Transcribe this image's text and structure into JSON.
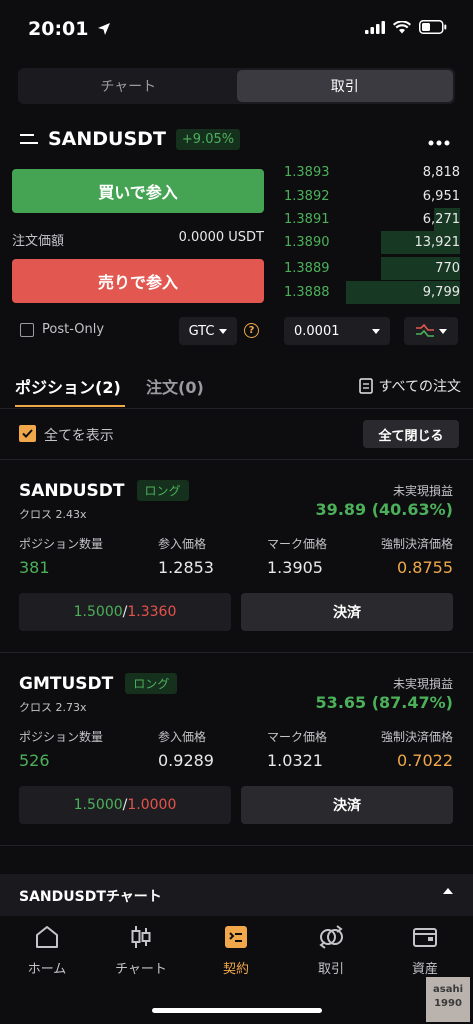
{
  "status_bar": {
    "time": "20:01"
  },
  "segmented": {
    "chart_label": "チャート",
    "trade_label": "取引"
  },
  "pair": {
    "name": "SANDUSDT",
    "change": "+9.05%"
  },
  "order_form": {
    "buy_label": "買いで参入",
    "sell_label": "売りで参入",
    "order_amount_label": "注文価額",
    "order_amount_value": "0.0000 USDT",
    "post_only_label": "Post-Only",
    "tif_value": "GTC",
    "help_glyph": "?"
  },
  "orderbook": {
    "step_value": "0.0001",
    "rows": [
      {
        "price": "1.3893",
        "qty": "8,818",
        "depth": 0.0
      },
      {
        "price": "1.3892",
        "qty": "6,951",
        "depth": 0.0
      },
      {
        "price": "1.3891",
        "qty": "6,271",
        "depth": 0.15
      },
      {
        "price": "1.3890",
        "qty": "13,921",
        "depth": 0.45
      },
      {
        "price": "1.3889",
        "qty": "770",
        "depth": 0.45
      },
      {
        "price": "1.3888",
        "qty": "9,799",
        "depth": 0.65
      }
    ]
  },
  "tabs": {
    "positions_label": "ポジション(2)",
    "orders_label": "注文(0)",
    "all_orders_label": "すべての注文"
  },
  "filters": {
    "show_all_label": "全てを表示",
    "close_all_label": "全て閉じる"
  },
  "position_headers": {
    "pnl": "未実現損益",
    "qty": "ポジション数量",
    "entry": "参入価格",
    "mark": "マーク価格",
    "liq": "強制決済価格",
    "settle": "決済"
  },
  "positions": [
    {
      "symbol": "SANDUSDT",
      "side": "ロング",
      "cross": "クロス 2.43x",
      "pnl": "39.89 (40.63%)",
      "qty": "381",
      "entry": "1.2853",
      "mark": "1.3905",
      "liq": "0.8755",
      "tp": "1.5000",
      "sep": "/",
      "sl": "1.3360"
    },
    {
      "symbol": "GMTUSDT",
      "side": "ロング",
      "cross": "クロス 2.73x",
      "pnl": "53.65 (87.47%)",
      "qty": "526",
      "entry": "0.9289",
      "mark": "1.0321",
      "liq": "0.7022",
      "tp": "1.5000",
      "sep": "/",
      "sl": "1.0000"
    }
  ],
  "chart_panel": {
    "label": "SANDUSDTチャート"
  },
  "nav": {
    "home": "ホーム",
    "chart": "チャート",
    "contract": "契約",
    "trade": "取引",
    "assets": "資産"
  },
  "watermark": {
    "line1": "asahi",
    "line2": "1990"
  },
  "colors": {
    "green": "#4cb05a",
    "red": "#e25851",
    "orange": "#f0a84a",
    "background": "#0d0d0f"
  }
}
